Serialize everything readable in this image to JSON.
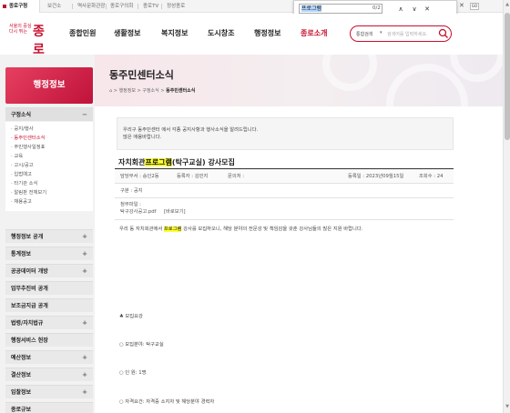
{
  "topbar": {
    "tabs": [
      "종로구청",
      "보건소",
      "역사문화관광",
      "종로구의회",
      "종로TV",
      "정성종로"
    ],
    "go_label": "GO"
  },
  "find": {
    "query": "프로그램",
    "count": "0/2"
  },
  "header": {
    "logo_small_1": "서울의 중심",
    "logo_small_2": "다시 뛰는",
    "logo_big": "종로",
    "nav": [
      "종합민원",
      "생활정보",
      "복지정보",
      "도시창조",
      "행정정보",
      "종로소개"
    ],
    "search": {
      "scope": "통합검색",
      "placeholder": "검색어를 입력하세요."
    }
  },
  "sidebar": {
    "title": "행정정보",
    "open_group": "구정소식",
    "sub_items": [
      "공지/행사",
      "동주민센터소식",
      "주민행사일정표",
      "교육",
      "고시/공고",
      "입법예고",
      "타기관 소식",
      "알림판 전체보기",
      "채용공고"
    ],
    "groups": [
      "행정정보 공개",
      "통계정보",
      "공공데이터 개방",
      "업무추진비 공개",
      "보조금지급 공개",
      "법령/자치법규",
      "행정서비스 헌장",
      "예산정보",
      "결산정보",
      "입찰정보",
      "종로규보"
    ]
  },
  "banner": {
    "title": "동주민센터소식",
    "breadcrumb": [
      "행정정보",
      "구정소식",
      "동주민센터소식"
    ]
  },
  "notice": {
    "line1": "우리구 동주민센터 에서 각종 공지사항과 행사소식을 알려드립니다.",
    "line2": "많은 애용바랍니다."
  },
  "post": {
    "title_prefix": "자치회관",
    "title_hl": "프로그램",
    "title_suffix": "(탁구교실) 강사모집",
    "dept": "담당부서 : 숭인2동",
    "author": "등록자 : 김민지",
    "contact": "문의처 :",
    "date": "등록일 : 2023년09월15일",
    "views": "조회수 : 24",
    "category": "구분 : 공지",
    "attach_label": "첨부파일 :",
    "attach_file": "탁구강사공고.pdf",
    "attach_preview": "[바로보기]",
    "intro_prefix": "우리 동 자치회관에서",
    "intro_hl": "프로그램",
    "intro_suffix": "강사를 모집하오니, 해당 분야의 전문성 및 책임감을 갖춘 강사님들의 많은 지원 바랍니다.",
    "section_title": "♣ 모집요강",
    "item1": "○ 모집분야: 탁구교실",
    "item2": "○ 인      원: 1명",
    "item3": "○ 자격요건: 자격증 소지자 및 해당분야 경력자"
  },
  "colors": {
    "brand": "#c8102e",
    "highlight": "#ffff33"
  }
}
